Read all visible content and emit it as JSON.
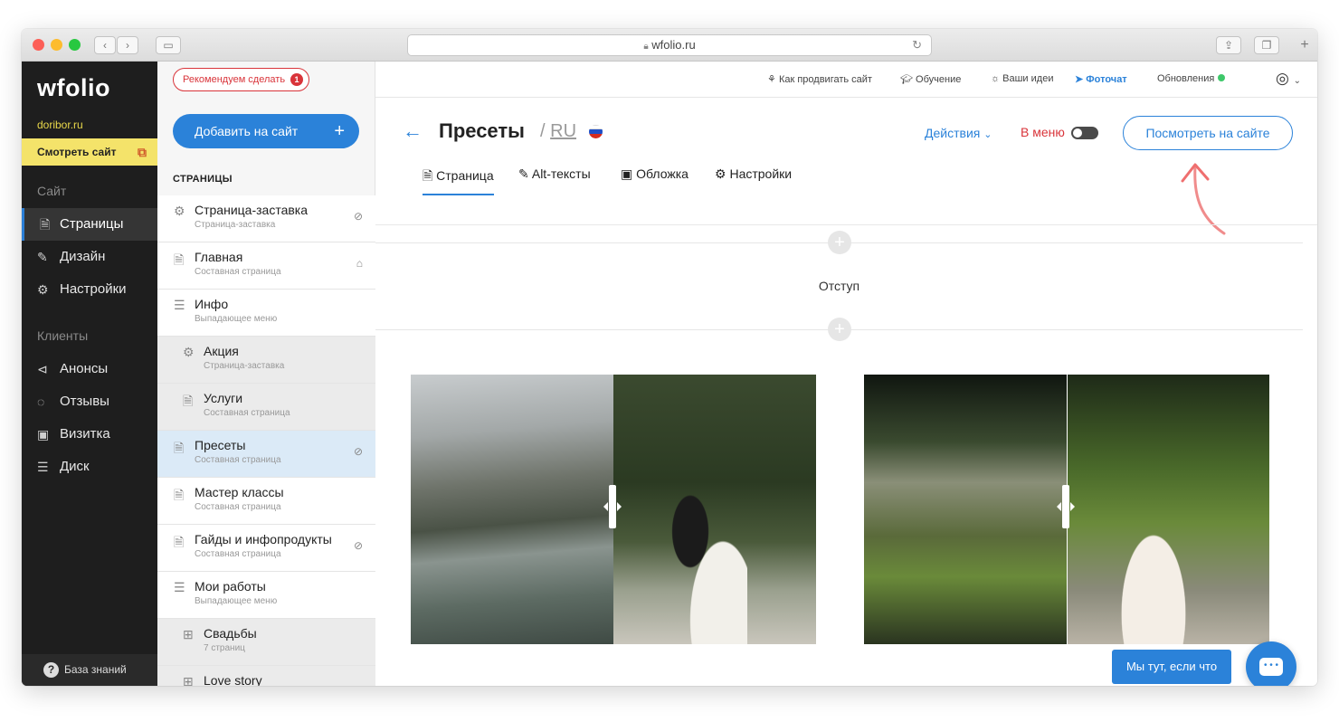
{
  "browser": {
    "url": "wfolio.ru"
  },
  "sidebar": {
    "logo": "wfolio",
    "domain": "doribor.ru",
    "view_site": "Смотреть сайт",
    "section_site": "Сайт",
    "section_clients": "Клиенты",
    "items": [
      {
        "label": "Страницы",
        "icon": "document-icon",
        "active": true
      },
      {
        "label": "Дизайн",
        "icon": "brush-icon"
      },
      {
        "label": "Настройки",
        "icon": "gear-icon"
      }
    ],
    "client_items": [
      {
        "label": "Анонсы",
        "icon": "megaphone-icon"
      },
      {
        "label": "Отзывы",
        "icon": "chat-icon"
      },
      {
        "label": "Визитка",
        "icon": "card-icon"
      },
      {
        "label": "Диск",
        "icon": "database-icon"
      }
    ],
    "knowledge_base": "База знаний"
  },
  "pages_panel": {
    "recommend": "Рекомендуем сделать",
    "recommend_count": "1",
    "add_button": "Добавить на сайт",
    "heading": "СТРАНИЦЫ",
    "items": [
      {
        "title": "Страница-заставка",
        "subtitle": "Страница-заставка"
      },
      {
        "title": "Главная",
        "subtitle": "Составная страница"
      },
      {
        "title": "Инфо",
        "subtitle": "Выпадающее меню"
      },
      {
        "title": "Акция",
        "subtitle": "Страница-заставка"
      },
      {
        "title": "Услуги",
        "subtitle": "Составная страница"
      },
      {
        "title": "Пресеты",
        "subtitle": "Составная страница"
      },
      {
        "title": "Мастер классы",
        "subtitle": "Составная страница"
      },
      {
        "title": "Гайды и инфопродукты",
        "subtitle": "Составная страница"
      },
      {
        "title": "Мои работы",
        "subtitle": "Выпадающее меню"
      },
      {
        "title": "Свадьбы",
        "subtitle": "7 страниц"
      },
      {
        "title": "Love story",
        "subtitle": ""
      }
    ]
  },
  "topbar": {
    "promote": "Как продвигать сайт",
    "learning": "Обучение",
    "ideas": "Ваши идеи",
    "photochat": "Фоточат",
    "updates": "Обновления"
  },
  "page": {
    "title": "Пресеты",
    "lang_sep": "/",
    "lang": "RU",
    "actions": "Действия",
    "in_menu": "В меню",
    "view_on_site": "Посмотреть на сайте",
    "tabs": [
      "Страница",
      "Alt-тексты",
      "Обложка",
      "Настройки"
    ],
    "spacer_label": "Отступ"
  },
  "chat": {
    "bubble": "Мы тут, если что"
  },
  "colors": {
    "accent": "#2b82d9",
    "danger": "#d9343a",
    "highlight": "#f4e36a",
    "sidebar": "#1e1e1e"
  }
}
